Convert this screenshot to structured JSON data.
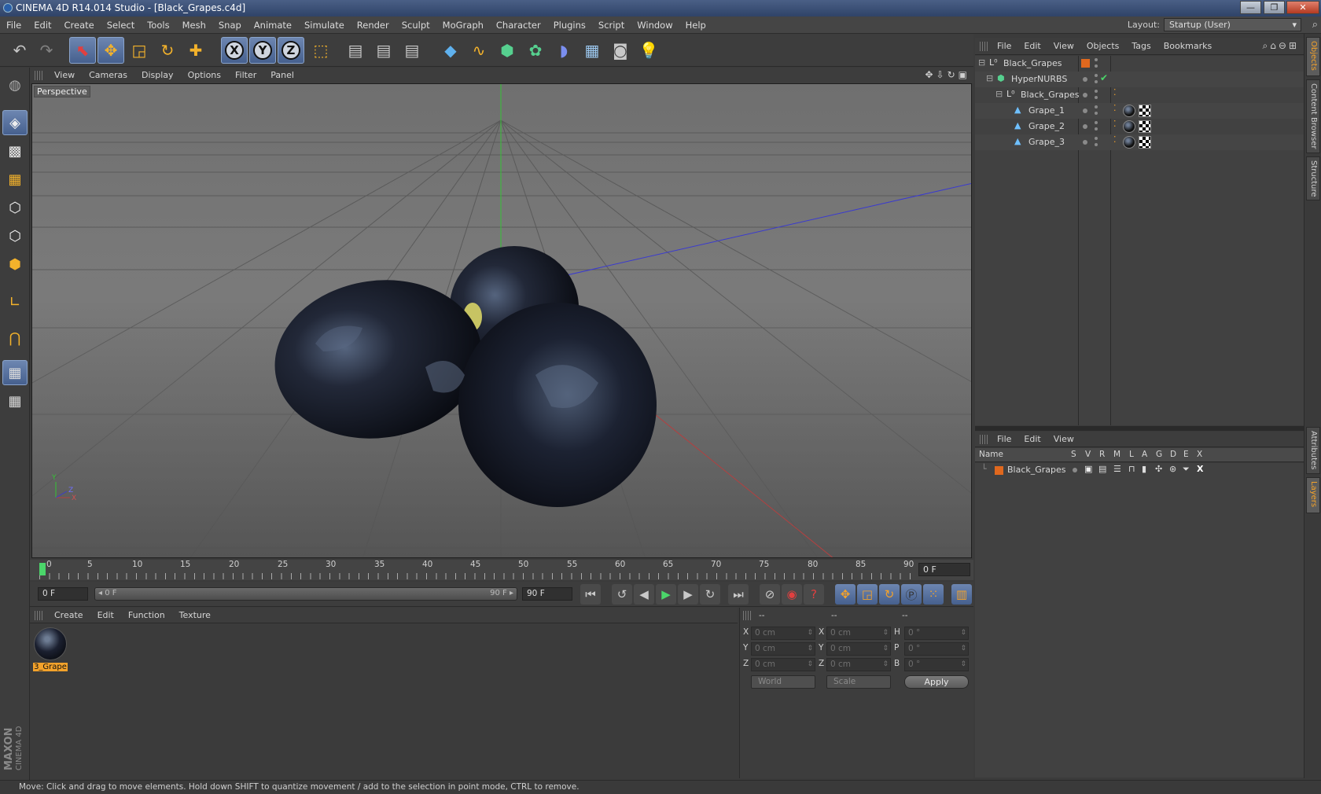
{
  "window": {
    "title": "CINEMA 4D R14.014 Studio - [Black_Grapes.c4d]",
    "minimize": "—",
    "maximize": "❐",
    "close": "✕"
  },
  "menubar": {
    "items": [
      "File",
      "Edit",
      "Create",
      "Select",
      "Tools",
      "Mesh",
      "Snap",
      "Animate",
      "Simulate",
      "Render",
      "Sculpt",
      "MoGraph",
      "Character",
      "Plugins",
      "Script",
      "Window",
      "Help"
    ],
    "layout_label": "Layout:",
    "layout_value": "Startup (User)"
  },
  "toolbar": {
    "x_axis": "X",
    "y_axis": "Y",
    "z_axis": "Z"
  },
  "viewport": {
    "menu": [
      "View",
      "Cameras",
      "Display",
      "Options",
      "Filter",
      "Panel"
    ],
    "label": "Perspective",
    "axis_y": "Y",
    "axis_z": "Z",
    "axis_x": "X"
  },
  "timeline": {
    "frames": [
      "0",
      "5",
      "10",
      "15",
      "20",
      "25",
      "30",
      "35",
      "40",
      "45",
      "50",
      "55",
      "60",
      "65",
      "70",
      "75",
      "80",
      "85",
      "90"
    ],
    "current_frame_field": "0 F"
  },
  "transport": {
    "start_field": "0 F",
    "range_start": "◂ 0 F",
    "range_end": "90 F ▸",
    "end_field": "90 F"
  },
  "material_manager": {
    "menu": [
      "Create",
      "Edit",
      "Function",
      "Texture"
    ],
    "material_name": "3_Grape"
  },
  "coordinates": {
    "headers": [
      "--",
      "--",
      "--"
    ],
    "pos_labels": [
      "X",
      "Y",
      "Z"
    ],
    "pos_values": [
      "0 cm",
      "0 cm",
      "0 cm"
    ],
    "size_labels": [
      "X",
      "Y",
      "Z"
    ],
    "size_values": [
      "0 cm",
      "0 cm",
      "0 cm"
    ],
    "rot_labels": [
      "H",
      "P",
      "B"
    ],
    "rot_values": [
      "0 °",
      "0 °",
      "0 °"
    ],
    "world_select": "World",
    "scale_select": "Scale",
    "apply_label": "Apply"
  },
  "object_manager": {
    "menu": [
      "File",
      "Edit",
      "View",
      "Objects",
      "Tags",
      "Bookmarks"
    ],
    "objects": [
      {
        "name": "Black_Grapes",
        "icon": "null-object-icon"
      },
      {
        "name": "HyperNURBS",
        "icon": "hypernurbs-icon"
      },
      {
        "name": "Black_Grapes",
        "icon": "null-object-icon"
      },
      {
        "name": "Grape_1",
        "icon": "polygon-object-icon"
      },
      {
        "name": "Grape_2",
        "icon": "polygon-object-icon"
      },
      {
        "name": "Grape_3",
        "icon": "polygon-object-icon"
      }
    ]
  },
  "layer_manager": {
    "menu": [
      "File",
      "Edit",
      "View"
    ],
    "columns": [
      "Name",
      "S",
      "V",
      "R",
      "M",
      "L",
      "A",
      "G",
      "D",
      "E",
      "X"
    ],
    "layers": [
      {
        "name": "Black_Grapes",
        "color": "#e0681e"
      }
    ]
  },
  "right_tabs": [
    "Objects",
    "Content Browser",
    "Structure",
    "Attributes",
    "Layers"
  ],
  "status": {
    "text": "Move: Click and drag to move elements. Hold down SHIFT to quantize movement / add to the selection in point mode, CTRL to remove."
  },
  "logo": {
    "maxon": "MAXON",
    "cinema": "CINEMA 4D"
  },
  "colors": {
    "accent_orange": "#f3a22b",
    "highlight_blue": "#5a74a0",
    "play_green": "#4bd66a"
  }
}
